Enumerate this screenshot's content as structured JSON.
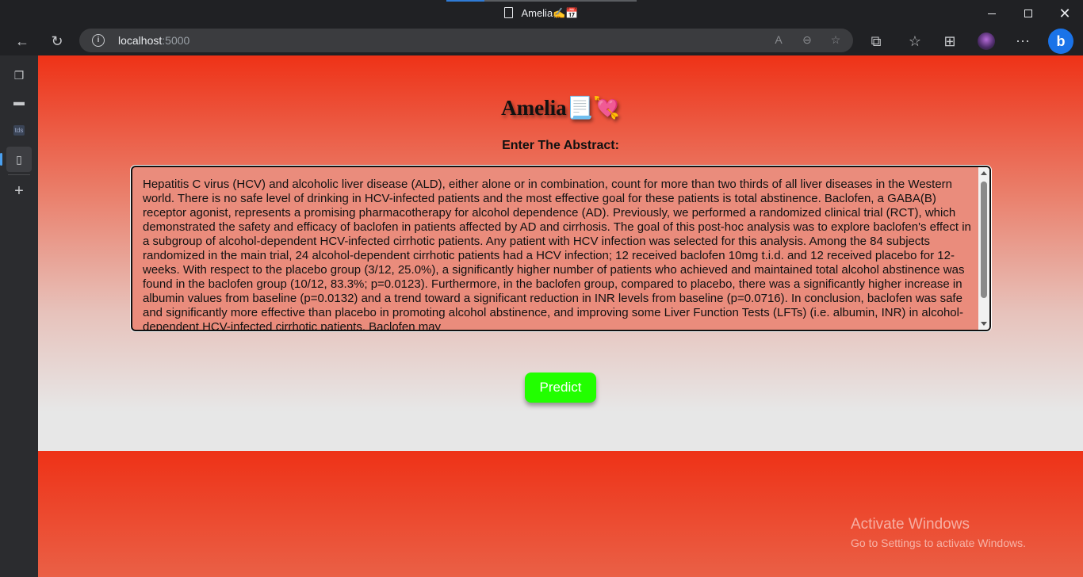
{
  "browser": {
    "tab_title": "Amelia✍️📅",
    "address": {
      "host": "localhost",
      "port": ":5000"
    }
  },
  "page": {
    "heading": "Amelia📃💘",
    "subheading": "Enter The Abstract:",
    "abstract_text": "Hepatitis C virus (HCV) and alcoholic liver disease (ALD), either alone or in combination, count for more than two thirds of all liver diseases in the Western world. There is no safe level of drinking in HCV-infected patients and the most effective goal for these patients is total abstinence. Baclofen, a GABA(B) receptor agonist, represents a promising pharmacotherapy for alcohol dependence (AD). Previously, we performed a randomized clinical trial (RCT), which demonstrated the safety and efficacy of baclofen in patients affected by AD and cirrhosis. The goal of this post-hoc analysis was to explore baclofen's effect in a subgroup of alcohol-dependent HCV-infected cirrhotic patients. Any patient with HCV infection was selected for this analysis. Among the 84 subjects randomized in the main trial, 24 alcohol-dependent cirrhotic patients had a HCV infection; 12 received baclofen 10mg t.i.d. and 12 received placebo for 12-weeks. With respect to the placebo group (3/12, 25.0%), a significantly higher number of patients who achieved and maintained total alcohol abstinence was found in the baclofen group (10/12, 83.3%; p=0.0123). Furthermore, in the baclofen group, compared to placebo, there was a significantly higher increase in albumin values from baseline (p=0.0132) and a trend toward a significant reduction in INR levels from baseline (p=0.0716). In conclusion, baclofen was safe and significantly more effective than placebo in promoting alcohol abstinence, and improving some Liver Function Tests (LFTs) (i.e. albumin, INR) in alcohol-dependent HCV-infected cirrhotic patients. Baclofen may",
    "predict_label": "Predict"
  },
  "os_watermark": {
    "line1": "Activate Windows",
    "line2": "Go to Settings to activate Windows."
  },
  "colors": {
    "page_top": "#ee3217",
    "predict_button": "#22ff00"
  }
}
